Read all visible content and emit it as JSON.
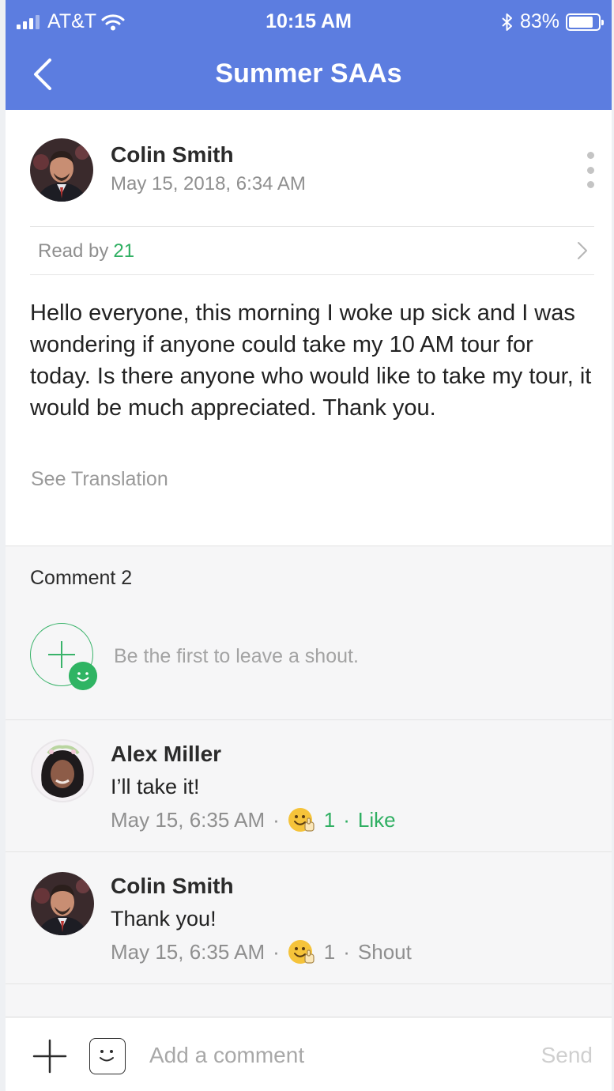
{
  "status_bar": {
    "carrier": "AT&T",
    "time": "10:15 AM",
    "battery": "83%",
    "battery_level": 0.83
  },
  "nav": {
    "title": "Summer SAAs"
  },
  "post": {
    "author": "Colin Smith",
    "date": "May 15, 2018, 6:34 AM",
    "read_by_label": "Read by",
    "read_by_count": "21",
    "body": "Hello everyone, this morning I woke up sick and I was wondering if anyone could take my 10 AM tour for today. Is there anyone who would like to take my tour, it would be much appreciated. Thank you.",
    "see_translation": "See Translation"
  },
  "comments": {
    "heading": "Comment 2",
    "shout_prompt": "Be the first to leave a shout.",
    "items": [
      {
        "name": "Alex Miller",
        "text": "I’ll take it!",
        "time": "May 15, 6:35 AM",
        "sep": "·",
        "reaction_count": "1",
        "action": "Like"
      },
      {
        "name": "Colin Smith",
        "text": "Thank you!",
        "time": "May 15, 6:35 AM",
        "sep": "·",
        "reaction_count": "1",
        "action": "Shout"
      }
    ]
  },
  "composer": {
    "placeholder": "Add a comment",
    "send_label": "Send"
  },
  "colors": {
    "header_blue": "#5c7de0",
    "accent_green": "#2faf62"
  }
}
